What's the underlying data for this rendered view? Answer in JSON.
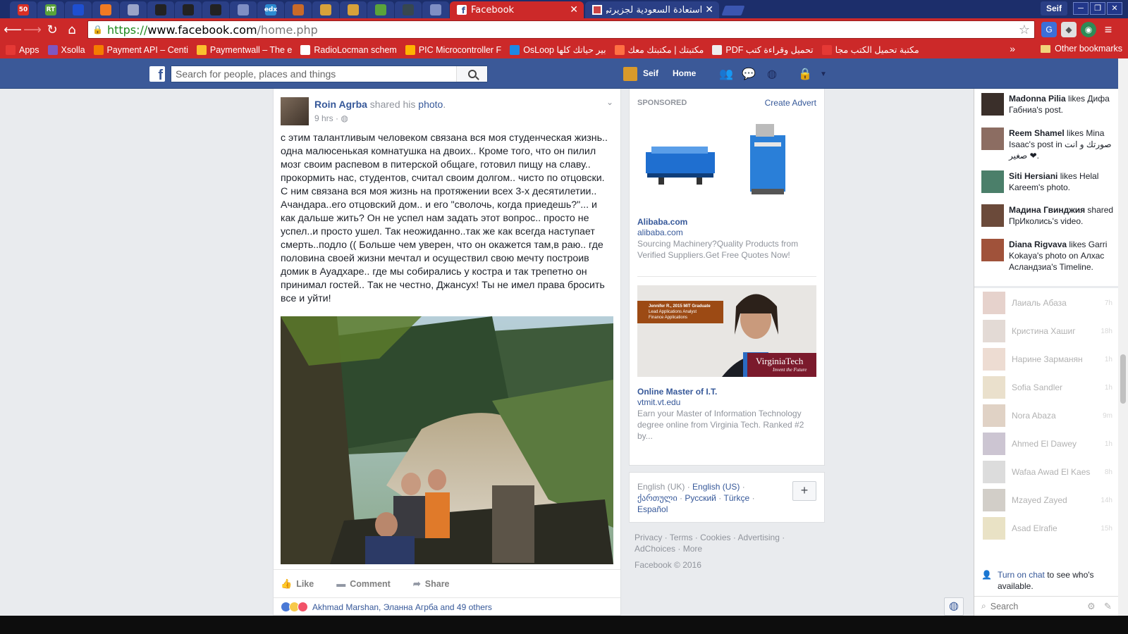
{
  "browser": {
    "pinned_tabs": [
      {
        "label": "50",
        "color": "#d93025"
      },
      {
        "label": "RT",
        "color": "#5aa33a"
      },
      {
        "label": "",
        "color": "#1e4fd1"
      },
      {
        "label": "",
        "color": "#f07a22"
      },
      {
        "label": "",
        "color": "#9aa4c8"
      },
      {
        "label": "",
        "color": "#222222"
      },
      {
        "label": "",
        "color": "#222222"
      },
      {
        "label": "",
        "color": "#222222"
      },
      {
        "label": "",
        "color": "#7f8fc4"
      },
      {
        "label": "edx",
        "color": "#2d8bd1"
      },
      {
        "label": "",
        "color": "#c96a28"
      },
      {
        "label": "",
        "color": "#d8a23a"
      },
      {
        "label": "",
        "color": "#d8a23a"
      },
      {
        "label": "",
        "color": "#5aa33a"
      },
      {
        "label": "",
        "color": "#37474f"
      },
      {
        "label": "",
        "color": "#7f8fc4"
      }
    ],
    "active_tab": {
      "title": "Facebook",
      "close": "✕"
    },
    "other_tab": {
      "title": "استعادة السعودية لجزيرتي",
      "close": "✕"
    },
    "window_user": "Seif",
    "window_controls": {
      "minimize": "─",
      "maximize": "❐",
      "close": "✕"
    },
    "url": {
      "scheme": "https://",
      "host": "www.facebook.com",
      "path": "/home.php"
    },
    "bookmarks": [
      {
        "label": "Apps",
        "color": "#e53935",
        "icon": "apps-grid-icon"
      },
      {
        "label": "Xsolla",
        "color": "#7e57c2",
        "icon": "xsolla-icon"
      },
      {
        "label": "Payment API – Centi",
        "color": "#f57c00",
        "icon": "info-icon"
      },
      {
        "label": "Paymentwall – The e",
        "color": "#fbc02d",
        "icon": "paymentwall-icon"
      },
      {
        "label": "RadioLocman schem",
        "color": "#ffffff",
        "icon": "rl-icon"
      },
      {
        "label": "PIC Microcontroller F",
        "color": "#ffb300",
        "icon": "pic-icon"
      },
      {
        "label": "OsLoop بير حياتك كلها",
        "color": "#1e88e5",
        "icon": "osloop-icon"
      },
      {
        "label": "مكتبتك | مكتبتك معك",
        "color": "#ff7043",
        "icon": "blogger-icon"
      },
      {
        "label": "PDF تحميل وقراءة كتب",
        "color": "#eeeeee",
        "icon": "pdf-icon"
      },
      {
        "label": "مكتبة تحميل الكتب مجا",
        "color": "#e53935",
        "icon": "book-download-icon"
      }
    ],
    "bookmarks_more": "»",
    "other_bookmarks": "Other bookmarks"
  },
  "fb_header": {
    "logo": "f",
    "search_placeholder": "Search for people, places and things",
    "user": "Seif",
    "home": "Home"
  },
  "story": {
    "author": "Roin Agrba",
    "action": " shared his ",
    "object": "photo",
    "object_suffix": ".",
    "time": "9 hrs",
    "time_sep": " · ",
    "text": "с этим талантливым человеком связана вся моя студенческая жизнь.. одна малюсенькая комнатушка на двоих.. Кроме того, что он пилил мозг своим распевом в питерской общаге, готовил пищу на славу.. прокормить нас, студентов, считал своим долгом.. чисто по отцовски. С ним связана вся моя жизнь на протяжении всех 3-х десятилетии.. Ачандара..его отцовский дом.. и его \"сволочь, когда приедешь?\"... и как дальше жить? Он не успел нам задать этот вопрос.. просто не успел..и просто ушел. Так неожиданно..так же как всегда наступает смерть..подло (( Больше чем уверен, что он окажется там,в раю.. где половина своей жизни мечтал и осуществил свою мечту построив домик в Ауадхаре.. где мы собирались у костра и так трепетно он принимал гостей.. Так не честно, Джансух! Ты не имел права бросить все и уйти!",
    "actions": {
      "like": "Like",
      "comment": "Comment",
      "share": "Share"
    },
    "likes_summary": "Akhmad Marshan, Эланна Агрба and 49 others"
  },
  "ads": {
    "header": "SPONSORED",
    "create": "Create Advert",
    "items": [
      {
        "title": "Alibaba.com",
        "domain": "alibaba.com",
        "desc": "Sourcing Machinery?Quality Products from Verified Suppliers.Get Free Quotes Now!"
      },
      {
        "title": "Online Master of I.T.",
        "domain": "vtmit.vt.edu",
        "desc": "Earn your Master of Information Technology degree online from Virginia Tech. Ranked #2 by..."
      }
    ],
    "vt_banner": {
      "caption": "Jennifer R., 2015 MIT Graduate",
      "role1": "Lead Applications Analyst",
      "role2": "Finance Applications",
      "brand": "VirginiaTech",
      "tagline": "Invent the Future"
    }
  },
  "languages": {
    "current": "English (UK)",
    "sep": " · ",
    "options": [
      "English (US)",
      "ქართული",
      "Русский",
      "Türkçe",
      "Español"
    ],
    "add": "+"
  },
  "footer": {
    "links": [
      "Privacy",
      "Terms",
      "Cookies",
      "Advertising",
      "AdChoices",
      "More"
    ],
    "copyright": "Facebook © 2016"
  },
  "ticker": [
    {
      "name": "Madonna Pilia",
      "text": " likes Дифа Габниа's post."
    },
    {
      "name": "Reem Shamel",
      "text": " likes Mina Isaac's post in صورتك و انت صغير ❤."
    },
    {
      "name": "Siti Hersiani",
      "text": " likes Helal Kareem's photo."
    },
    {
      "name": "Мадина Гвинджия",
      "text": " shared ПрИколись's video."
    },
    {
      "name": "Diana Rigvava",
      "text": " likes Garri Kokaya's photo on Алхас Асландзиа's Timeline."
    }
  ],
  "friends": [
    {
      "name": "Лаиаль Абаза",
      "time": "7h"
    },
    {
      "name": "Кристина Хашиг",
      "time": "18h"
    },
    {
      "name": "Нарине Зарманян",
      "time": "1h"
    },
    {
      "name": "Sofia Sandler",
      "time": "1h"
    },
    {
      "name": "Nora Abaza",
      "time": "9m"
    },
    {
      "name": "Ahmed El Dawey",
      "time": "1h"
    },
    {
      "name": "Wafaa Awad El Kaes",
      "time": "8h"
    },
    {
      "name": "Mzayed Zayed",
      "time": "14h"
    },
    {
      "name": "Asad Elrafie",
      "time": "15h"
    }
  ],
  "chat": {
    "turn_on": "Turn on chat",
    "turn_on_rest": " to see who's available.",
    "search_placeholder": "Search"
  }
}
